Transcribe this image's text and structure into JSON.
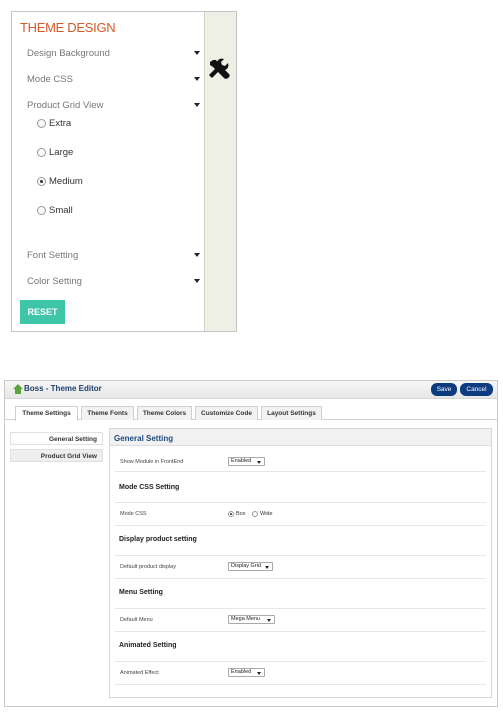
{
  "theme_panel": {
    "title": "THEME DESIGN",
    "rows": [
      {
        "label": "Design Background"
      },
      {
        "label": "Mode CSS"
      },
      {
        "label": "Product Grid View"
      },
      {
        "label": "Font Setting"
      },
      {
        "label": "Color Setting"
      }
    ],
    "grid_options": [
      {
        "label": "Extra",
        "selected": false
      },
      {
        "label": "Large",
        "selected": false
      },
      {
        "label": "Medium",
        "selected": true
      },
      {
        "label": "Small",
        "selected": false
      }
    ],
    "reset_label": "RESET",
    "toggle_icon": "tools-icon",
    "accent_color": "#d35a27",
    "reset_color": "#3fc6a8"
  },
  "editor": {
    "title": "Boss - Theme Editor",
    "save_label": "Save",
    "cancel_label": "Cancel",
    "tabs": [
      {
        "label": "Theme Settings",
        "active": true
      },
      {
        "label": "Theme Fonts",
        "active": false
      },
      {
        "label": "Theme Colors",
        "active": false
      },
      {
        "label": "Customize Code",
        "active": false
      },
      {
        "label": "Layout Settings",
        "active": false
      }
    ],
    "sidebar": [
      {
        "label": "General Setting"
      },
      {
        "label": "Product Grid View"
      }
    ],
    "box_title": "General Setting",
    "module_label": "Show Module in FrontEnd",
    "module_value": "Enabled",
    "mode_css_section": "Mode CSS Setting",
    "mode_css_label": "Mode CSS",
    "mode_css_options": [
      {
        "label": "Box",
        "selected": true
      },
      {
        "label": "Wide",
        "selected": false
      }
    ],
    "display_section": "Display product setting",
    "display_label": "Default product display",
    "display_value": "Display Grid",
    "menu_section": "Menu Setting",
    "menu_label": "Default Menu",
    "menu_value": "Mega Menu",
    "animated_section": "Animated Setting",
    "animated_label": "Animated Effect",
    "animated_value": "Enabled",
    "button_color": "#0d3b7f",
    "title_color": "#1d4a80"
  }
}
